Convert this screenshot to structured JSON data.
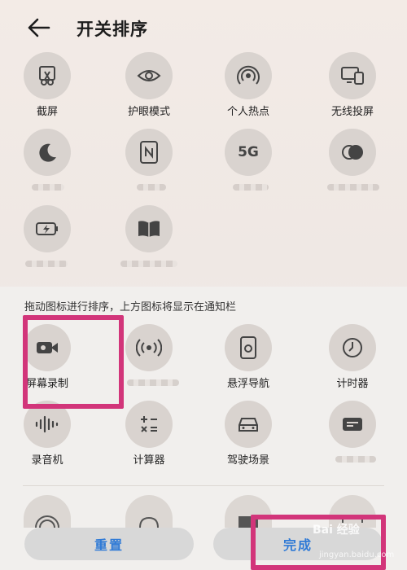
{
  "header": {
    "title": "开关排序"
  },
  "top_tiles": [
    {
      "label": "截屏",
      "icon": "screenshot-icon"
    },
    {
      "label": "护眼模式",
      "icon": "eye-icon"
    },
    {
      "label": "个人热点",
      "icon": "hotspot-icon"
    },
    {
      "label": "无线投屏",
      "icon": "cast-icon"
    },
    {
      "label": "",
      "icon": "moon-icon"
    },
    {
      "label": "",
      "icon": "nfc-icon"
    },
    {
      "label": "",
      "icon": "5g-icon",
      "glyph": "5G"
    },
    {
      "label": "",
      "icon": "dark-mode-icon"
    },
    {
      "label": "",
      "icon": "battery-icon"
    },
    {
      "label": "",
      "icon": "book-icon"
    }
  ],
  "hint": "拖动图标进行排序，上方图标将显示在通知栏",
  "bottom_tiles": [
    {
      "label": "屏幕录制",
      "icon": "screen-record-icon"
    },
    {
      "label": "",
      "icon": "broadcast-icon"
    },
    {
      "label": "悬浮导航",
      "icon": "floating-nav-icon"
    },
    {
      "label": "计时器",
      "icon": "timer-icon"
    },
    {
      "label": "录音机",
      "icon": "recorder-icon"
    },
    {
      "label": "计算器",
      "icon": "calculator-icon"
    },
    {
      "label": "驾驶场景",
      "icon": "car-icon"
    },
    {
      "label": "",
      "icon": "wallet-icon"
    }
  ],
  "buttons": {
    "reset": "重置",
    "done": "完成"
  },
  "watermark": {
    "main": "Bai 经验",
    "sub": "jingyan.baidu.com"
  },
  "colors": {
    "accent": "#2f7ad6",
    "highlight": "#d2357a",
    "icon_bg": "#d9d3cf"
  }
}
